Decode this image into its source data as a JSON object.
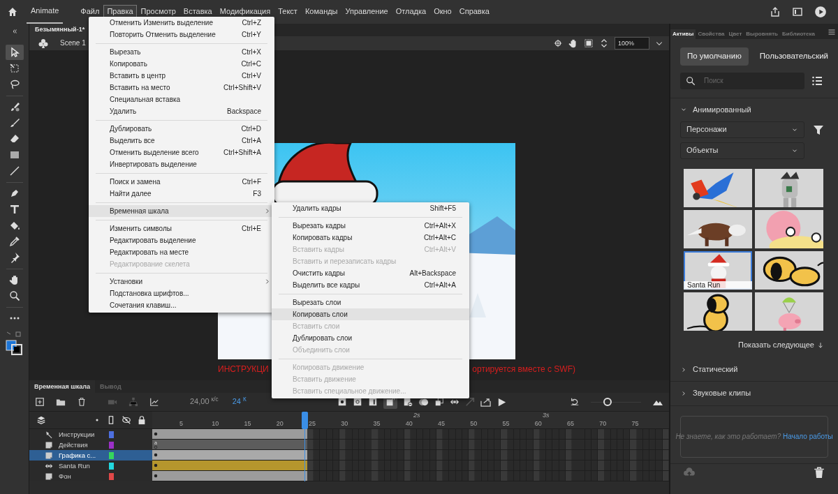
{
  "app": {
    "title": "Animate"
  },
  "menu_bar": [
    {
      "label": "Файл",
      "selected": false
    },
    {
      "label": "Правка",
      "selected": true
    },
    {
      "label": "Просмотр",
      "selected": false
    },
    {
      "label": "Вставка",
      "selected": false
    },
    {
      "label": "Модификация",
      "selected": false
    },
    {
      "label": "Текст",
      "selected": false
    },
    {
      "label": "Команды",
      "selected": false
    },
    {
      "label": "Управление",
      "selected": false
    },
    {
      "label": "Отладка",
      "selected": false
    },
    {
      "label": "Окно",
      "selected": false
    },
    {
      "label": "Справка",
      "selected": false
    }
  ],
  "tools": [
    {
      "kind": "select",
      "selected": true
    },
    {
      "kind": "transform",
      "selected": false
    },
    {
      "kind": "lasso",
      "selected": false
    },
    {
      "kind": "divider"
    },
    {
      "kind": "paintbrush",
      "selected": false
    },
    {
      "kind": "brush",
      "selected": false
    },
    {
      "kind": "eraser",
      "selected": false
    },
    {
      "kind": "rect",
      "selected": false
    },
    {
      "kind": "line",
      "selected": false
    },
    {
      "kind": "divider"
    },
    {
      "kind": "pen",
      "selected": false
    },
    {
      "kind": "text",
      "selected": false
    },
    {
      "kind": "bucket",
      "selected": false
    },
    {
      "kind": "dropper",
      "selected": false
    },
    {
      "kind": "pin",
      "selected": false
    },
    {
      "kind": "divider"
    },
    {
      "kind": "hand",
      "selected": false
    },
    {
      "kind": "zoom",
      "selected": false
    },
    {
      "kind": "divider"
    },
    {
      "kind": "more",
      "selected": false
    },
    {
      "kind": "colors"
    }
  ],
  "document_tab": {
    "title": "Безымянный-1*"
  },
  "scene": {
    "label": "Scene 1"
  },
  "zoom": {
    "value": "100%"
  },
  "stage": {
    "notes": [
      "ИНСТРУКЦИ",
      "ортируется вместе с SWF)"
    ]
  },
  "edit_menu": {
    "items": [
      {
        "kind": "item",
        "label": "Отменить Изменить выделение",
        "shortcut": "Ctrl+Z",
        "disabled": false,
        "selected": false
      },
      {
        "kind": "item",
        "label": "Повторить Отменить выделение",
        "shortcut": "Ctrl+Y",
        "disabled": false,
        "selected": false
      },
      {
        "kind": "separator"
      },
      {
        "kind": "item",
        "label": "Вырезать",
        "shortcut": "Ctrl+X",
        "disabled": false,
        "selected": false
      },
      {
        "kind": "item",
        "label": "Копировать",
        "shortcut": "Ctrl+C",
        "disabled": false,
        "selected": false
      },
      {
        "kind": "item",
        "label": "Вставить в центр",
        "shortcut": "Ctrl+V",
        "disabled": false,
        "selected": false
      },
      {
        "kind": "item",
        "label": "Вставить на место",
        "shortcut": "Ctrl+Shift+V",
        "disabled": false,
        "selected": false
      },
      {
        "kind": "item",
        "label": "Специальная вставка",
        "disabled": false,
        "selected": false
      },
      {
        "kind": "item",
        "label": "Удалить",
        "shortcut": "Backspace",
        "disabled": false,
        "selected": false
      },
      {
        "kind": "separator"
      },
      {
        "kind": "item",
        "label": "Дублировать",
        "shortcut": "Ctrl+D",
        "disabled": false,
        "selected": false
      },
      {
        "kind": "item",
        "label": "Выделить все",
        "shortcut": "Ctrl+A",
        "disabled": false,
        "selected": false
      },
      {
        "kind": "item",
        "label": "Отменить выделение всего",
        "shortcut": "Ctrl+Shift+A",
        "disabled": false,
        "selected": false
      },
      {
        "kind": "item",
        "label": "Инвертировать выделение",
        "disabled": false,
        "selected": false
      },
      {
        "kind": "separator"
      },
      {
        "kind": "item",
        "label": "Поиск и замена",
        "shortcut": "Ctrl+F",
        "disabled": false,
        "selected": false
      },
      {
        "kind": "item",
        "label": "Найти далее",
        "shortcut": "F3",
        "disabled": false,
        "selected": false
      },
      {
        "kind": "separator"
      },
      {
        "kind": "item",
        "label": "Временная шкала",
        "submenu": true,
        "disabled": false,
        "selected": true
      },
      {
        "kind": "separator"
      },
      {
        "kind": "item",
        "label": "Изменить символы",
        "shortcut": "Ctrl+E",
        "disabled": false,
        "selected": false
      },
      {
        "kind": "item",
        "label": "Редактировать выделение",
        "disabled": false,
        "selected": false
      },
      {
        "kind": "item",
        "label": "Редактировать на месте",
        "disabled": false,
        "selected": false
      },
      {
        "kind": "item",
        "label": "Редактирование скелета",
        "disabled": true,
        "selected": false
      },
      {
        "kind": "separator"
      },
      {
        "kind": "item",
        "label": "Установки",
        "submenu": true,
        "disabled": false,
        "selected": false
      },
      {
        "kind": "item",
        "label": "Подстановка шрифтов...",
        "disabled": false,
        "selected": false
      },
      {
        "kind": "item",
        "label": "Сочетания клавиш...",
        "disabled": false,
        "selected": false
      }
    ]
  },
  "timeline_submenu": {
    "items": [
      {
        "kind": "item",
        "label": "Удалить кадры",
        "shortcut": "Shift+F5",
        "disabled": false,
        "selected": false
      },
      {
        "kind": "separator"
      },
      {
        "kind": "item",
        "label": "Вырезать кадры",
        "shortcut": "Ctrl+Alt+X",
        "disabled": false,
        "selected": false
      },
      {
        "kind": "item",
        "label": "Копировать кадры",
        "shortcut": "Ctrl+Alt+C",
        "disabled": false,
        "selected": false
      },
      {
        "kind": "item",
        "label": "Вставить кадры",
        "shortcut": "Ctrl+Alt+V",
        "disabled": true,
        "selected": false
      },
      {
        "kind": "item",
        "label": "Вставить и перезаписать кадры",
        "disabled": true,
        "selected": false
      },
      {
        "kind": "item",
        "label": "Очистить кадры",
        "shortcut": "Alt+Backspace",
        "disabled": false,
        "selected": false
      },
      {
        "kind": "item",
        "label": "Выделить все кадры",
        "shortcut": "Ctrl+Alt+A",
        "disabled": false,
        "selected": false
      },
      {
        "kind": "separator"
      },
      {
        "kind": "item",
        "label": "Вырезать слои",
        "disabled": false,
        "selected": false
      },
      {
        "kind": "item",
        "label": "Копировать слои",
        "disabled": false,
        "selected": true
      },
      {
        "kind": "item",
        "label": "Вставить слои",
        "disabled": true,
        "selected": false
      },
      {
        "kind": "item",
        "label": "Дублировать слои",
        "disabled": false,
        "selected": false
      },
      {
        "kind": "item",
        "label": "Объединить слои",
        "disabled": true,
        "selected": false
      },
      {
        "kind": "separator"
      },
      {
        "kind": "item",
        "label": "Копировать движение",
        "disabled": true,
        "selected": false
      },
      {
        "kind": "item",
        "label": "Вставить движение",
        "disabled": true,
        "selected": false
      },
      {
        "kind": "item",
        "label": "Вставить специальное движение...",
        "disabled": true,
        "selected": false
      }
    ]
  },
  "assets_panel": {
    "tabs": [
      {
        "label": "Активы",
        "selected": true
      },
      {
        "label": "Свойства",
        "selected": false
      },
      {
        "label": "Цвет",
        "selected": false
      },
      {
        "label": "Выровнять",
        "selected": false
      },
      {
        "label": "Библиотека",
        "selected": false
      }
    ],
    "modes": [
      {
        "label": "По умолчанию",
        "selected": true
      },
      {
        "label": "Пользовательский",
        "selected": false
      }
    ],
    "search": {
      "placeholder": "Поиск"
    },
    "sections": [
      {
        "label": "Анимированный",
        "expanded": true,
        "filters": [
          "Персонажи",
          "Объекты"
        ],
        "thumbnails": [
          {
            "kind": "picture",
            "selected": false
          },
          {
            "kind": "picture",
            "selected": false
          },
          {
            "kind": "picture",
            "selected": false
          },
          {
            "kind": "picture",
            "selected": false
          },
          {
            "kind": "picture",
            "selected": true,
            "caption": "Santa Run"
          },
          {
            "kind": "picture",
            "selected": false
          },
          {
            "kind": "picture",
            "selected": false
          },
          {
            "kind": "picture",
            "selected": false
          }
        ],
        "show_more": "Показать следующее"
      },
      {
        "label": "Статический",
        "expanded": false
      },
      {
        "label": "Звуковые клипы",
        "expanded": false
      }
    ],
    "help": {
      "text": "Не знаете, как это работает?",
      "link": "Начало работы"
    }
  },
  "timeline": {
    "tabs": [
      {
        "label": "Временная шкала",
        "selected": true
      },
      {
        "label": "Вывод",
        "selected": false
      }
    ],
    "fps": "24,00 $^{к/с}$",
    "frame": "24 $^{К}$",
    "zoom_slider": {
      "level": 0.33
    },
    "ruler": {
      "frames": [
        "5",
        "10",
        "15",
        "20",
        "25",
        "30",
        "35",
        "40",
        "45",
        "50",
        "55",
        "60",
        "65",
        "70",
        "75"
      ],
      "seconds": [
        "2s",
        "3s"
      ]
    },
    "layers": [
      {
        "name": "Инструкции",
        "kind": "guide",
        "color": "#4d6fe0",
        "selected": false,
        "empty_keyframe": false
      },
      {
        "name": "Действия",
        "kind": "layer",
        "color": "#9b30c8",
        "selected": false,
        "empty_keyframe": true,
        "frame_mark": "a"
      },
      {
        "name": "Графика с...",
        "kind": "layer",
        "color": "#36d65c",
        "selected": true,
        "empty_keyframe": false
      },
      {
        "name": "Santa Run",
        "kind": "symbol",
        "color": "#22d8e0",
        "selected": false,
        "empty_keyframe": false
      },
      {
        "name": "Фон",
        "kind": "layer",
        "color": "#e04848",
        "selected": false,
        "empty_keyframe": false
      }
    ]
  }
}
